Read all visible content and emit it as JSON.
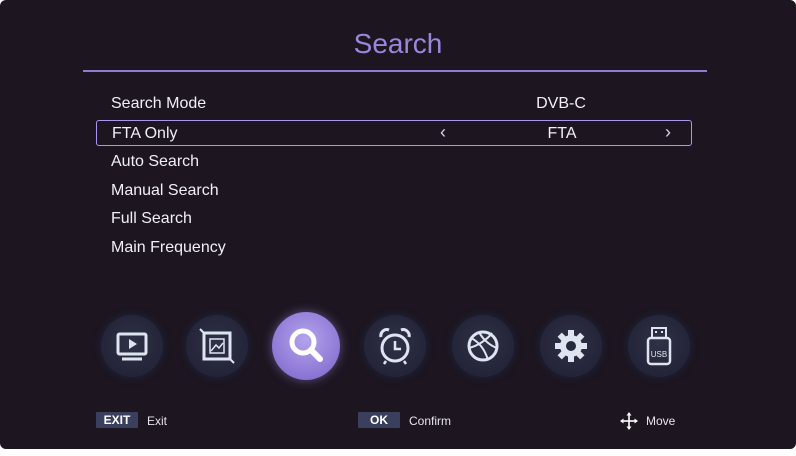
{
  "header": {
    "title": "Search"
  },
  "menu": {
    "items": [
      {
        "label": "Search Mode",
        "value": "DVB-C"
      },
      {
        "label": "FTA Only",
        "value": "FTA",
        "selected": true,
        "left_arrow": "‹",
        "right_arrow": "›"
      },
      {
        "label": "Auto Search",
        "value": ""
      },
      {
        "label": "Manual Search",
        "value": ""
      },
      {
        "label": "Full Search",
        "value": ""
      },
      {
        "label": "Main Frequency",
        "value": ""
      }
    ]
  },
  "icon_bar": {
    "items": [
      {
        "icon": "tv-icon",
        "active": false
      },
      {
        "icon": "picture-icon",
        "active": false
      },
      {
        "icon": "search-icon",
        "active": true
      },
      {
        "icon": "alarm-clock-icon",
        "active": false
      },
      {
        "icon": "ball-icon",
        "active": false
      },
      {
        "icon": "gear-icon",
        "active": false
      },
      {
        "icon": "usb-icon",
        "active": false
      }
    ],
    "usb_text": "USB"
  },
  "footer": {
    "exit_key": "EXIT",
    "exit_label": "Exit",
    "ok_key": "OK",
    "ok_label": "Confirm",
    "move_label": "Move"
  },
  "colors": {
    "background": "#1d1621",
    "accent": "#9a86dc",
    "active_icon": "#8c76d4",
    "key_bg": "#3b3f5e"
  }
}
